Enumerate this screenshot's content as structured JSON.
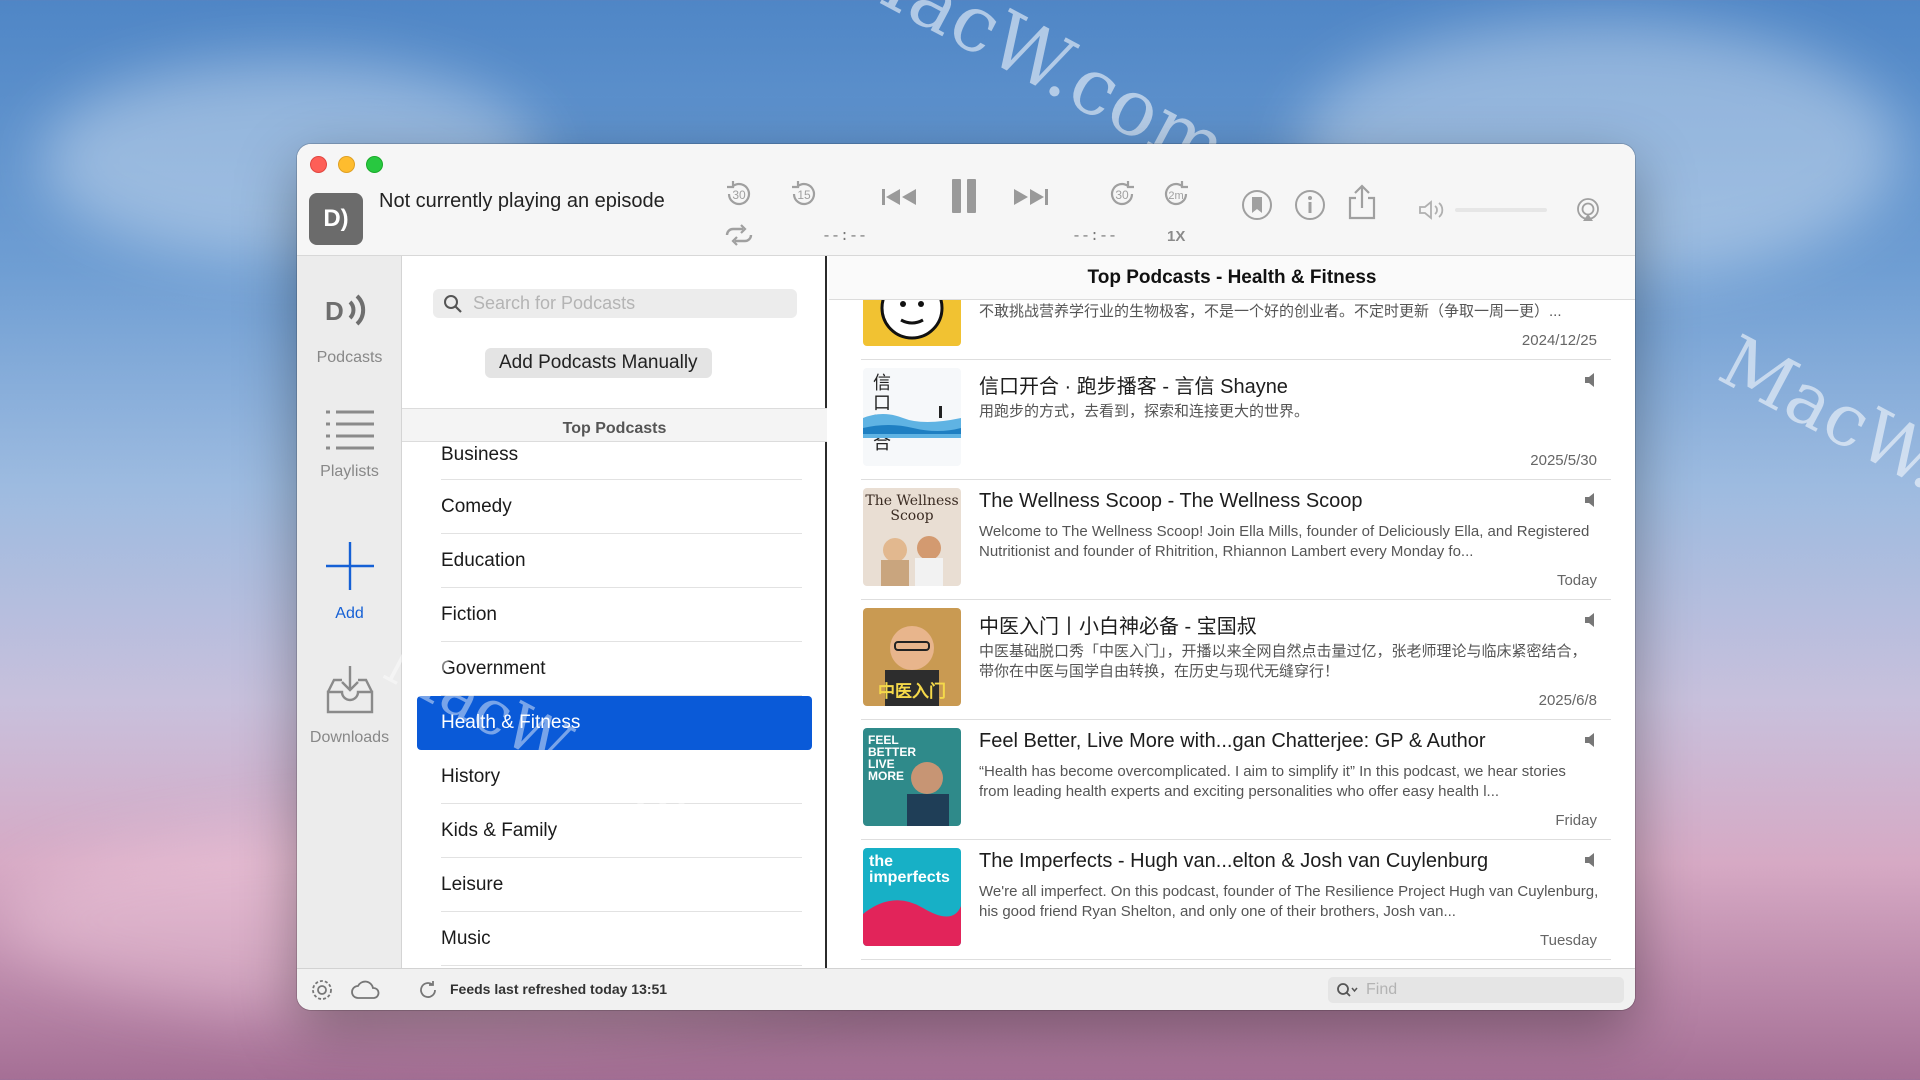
{
  "desktop": {
    "watermarks": [
      "MacW.com",
      "MacW.c",
      "MacW.com"
    ]
  },
  "titlebar": {
    "now_playing": "Not currently playing an episode",
    "app_icon_text": "D)",
    "skip_back_30": "30",
    "skip_back_15": "15",
    "skip_fwd_30": "30",
    "skip_fwd_2m": "2m",
    "time_elapsed": "--:--",
    "time_remaining": "--:--",
    "speed": "1X"
  },
  "sidebar": {
    "items": [
      {
        "label": "Podcasts",
        "icon": "podcasts-icon"
      },
      {
        "label": "Playlists",
        "icon": "list-icon"
      },
      {
        "label": "Add",
        "icon": "plus-icon"
      },
      {
        "label": "Downloads",
        "icon": "downloads-icon"
      }
    ]
  },
  "middle": {
    "search_placeholder": "Search for Podcasts",
    "add_manual_label": "Add Podcasts Manually",
    "section_title": "Top Podcasts",
    "categories": [
      "Business",
      "Comedy",
      "Education",
      "Fiction",
      "Government",
      "Health & Fitness",
      "History",
      "Kids & Family",
      "Leisure",
      "Music"
    ],
    "selected_category": "Health & Fitness"
  },
  "right": {
    "header": "Top Podcasts - Health & Fitness",
    "episodes": [
      {
        "title": "",
        "desc": "我是宋卅京，欢迎来到我的播客。一个热衷于改变世界的主播，不是一个好的产品经理。一个不敢挑战营养学行业的生物极客，不是一个好的创业者。不定时更新（争取一周一更）...",
        "date": "2024/12/25"
      },
      {
        "title": "信口开合 · 跑步播客 - 言信 Shayne",
        "desc": "用跑步的方式，去看到，探索和连接更大的世界。",
        "date": "2025/5/30",
        "art_text": "信口开合"
      },
      {
        "title": "The Wellness Scoop - The Wellness Scoop",
        "desc": "Welcome to The Wellness Scoop! Join Ella Mills, founder of Deliciously Ella, and Registered Nutritionist and founder of Rhitrition, Rhiannon Lambert every Monday fo...",
        "date": "Today",
        "art_text": "The Wellness Scoop"
      },
      {
        "title": "中医入门丨小白神必备 - 宝国叔",
        "desc": "中医基础脱口秀「中医入门」，开播以来全网自然点击量过亿，张老师理论与临床紧密结合，带你在中医与国学自由转换，在历史与现代无缝穿行！",
        "date": "2025/6/8",
        "art_text": "中医入门"
      },
      {
        "title": "Feel Better, Live More with...gan Chatterjee: GP & Author",
        "desc": "“Health has become overcomplicated. I aim to simplify it” In this podcast, we hear stories from leading health experts and exciting personalities who offer easy health l...",
        "date": "Friday",
        "art_text": "FEEL BETTER LIVE MORE"
      },
      {
        "title": "The Imperfects - Hugh van...elton & Josh van Cuylenburg",
        "desc": "We're all imperfect. On this podcast, founder of The Resilience Project Hugh van Cuylenburg, his good friend Ryan Shelton, and only one of their brothers, Josh van...",
        "date": "Tuesday",
        "art_text": "the imperfects"
      }
    ]
  },
  "statusbar": {
    "refresh_text": "Feeds last refreshed today 13:51",
    "find_placeholder": "Find"
  },
  "colors": {
    "accent": "#0a5ad8",
    "add_blue": "#1560d5",
    "close": "#fe5f57",
    "minimize": "#febc2e",
    "maximize": "#28c840"
  }
}
